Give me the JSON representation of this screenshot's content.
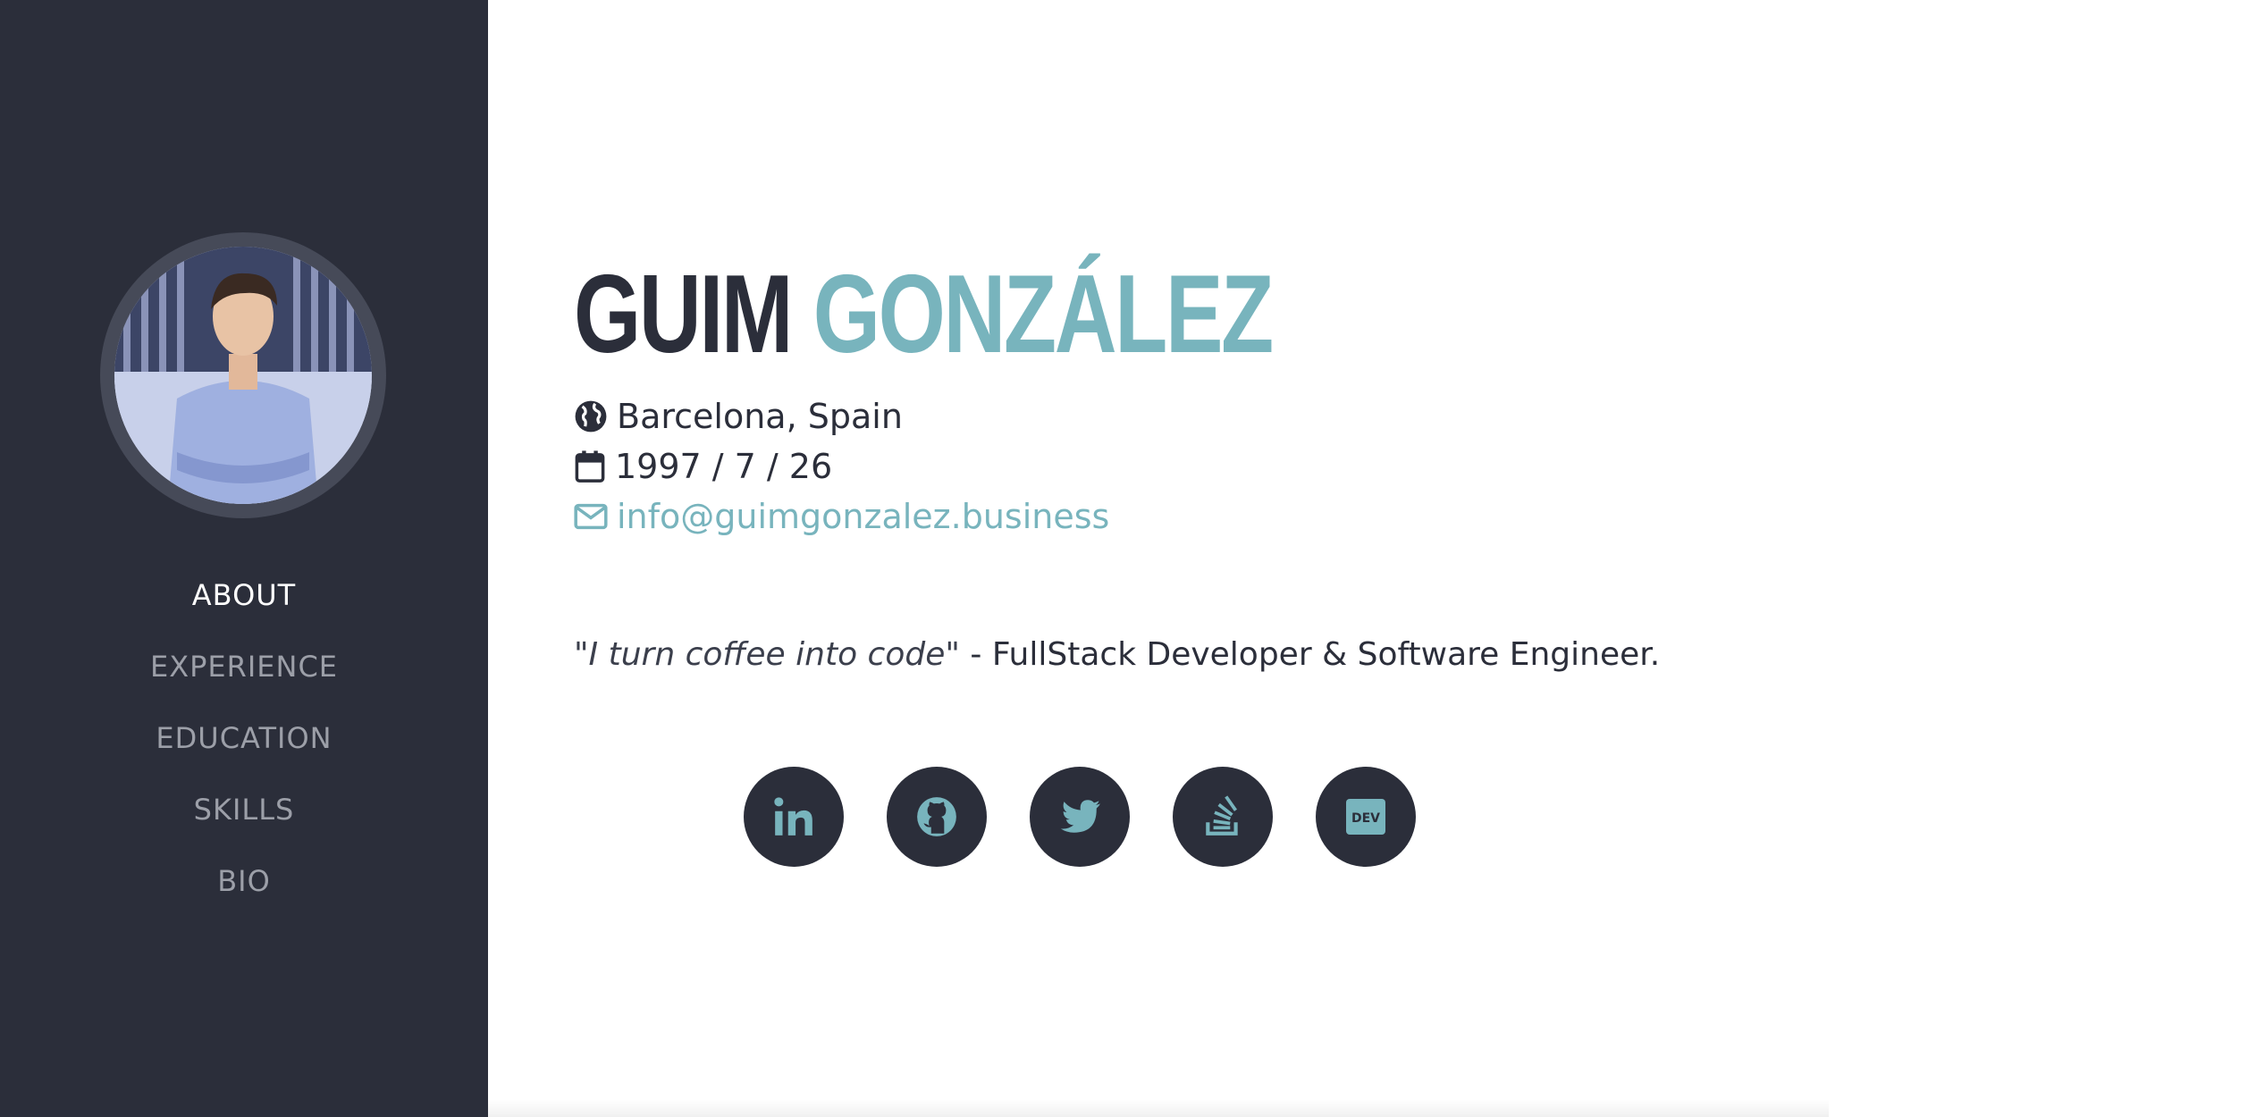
{
  "sidebar": {
    "avatar_alt": "Profile photo",
    "nav": [
      {
        "label": "ABOUT",
        "active": true
      },
      {
        "label": "EXPERIENCE",
        "active": false
      },
      {
        "label": "EDUCATION",
        "active": false
      },
      {
        "label": "SKILLS",
        "active": false
      },
      {
        "label": "BIO",
        "active": false
      }
    ]
  },
  "profile": {
    "first_name": "GUIM",
    "last_name": "GONZÁLEZ",
    "location": "Barcelona, Spain",
    "birthdate": "1997 / 7 / 26",
    "email": "info@guimgonzalez.business",
    "quote": "\"I turn coffee into code\"",
    "tagline_rest": " - FullStack Developer & Software Engineer."
  },
  "icons": {
    "location": "globe-icon",
    "birthdate": "calendar-icon",
    "email": "envelope-icon"
  },
  "socials": [
    {
      "name": "linkedin",
      "icon": "linkedin-icon"
    },
    {
      "name": "github",
      "icon": "github-icon"
    },
    {
      "name": "twitter",
      "icon": "twitter-icon"
    },
    {
      "name": "stackoverflow",
      "icon": "stackoverflow-icon"
    },
    {
      "name": "dev",
      "icon": "dev-icon",
      "label": "DEV"
    }
  ],
  "colors": {
    "sidebar_bg": "#2b2e3a",
    "accent": "#78b4bd",
    "text": "#2b2e3a",
    "nav_inactive": "#9c9fa8"
  }
}
